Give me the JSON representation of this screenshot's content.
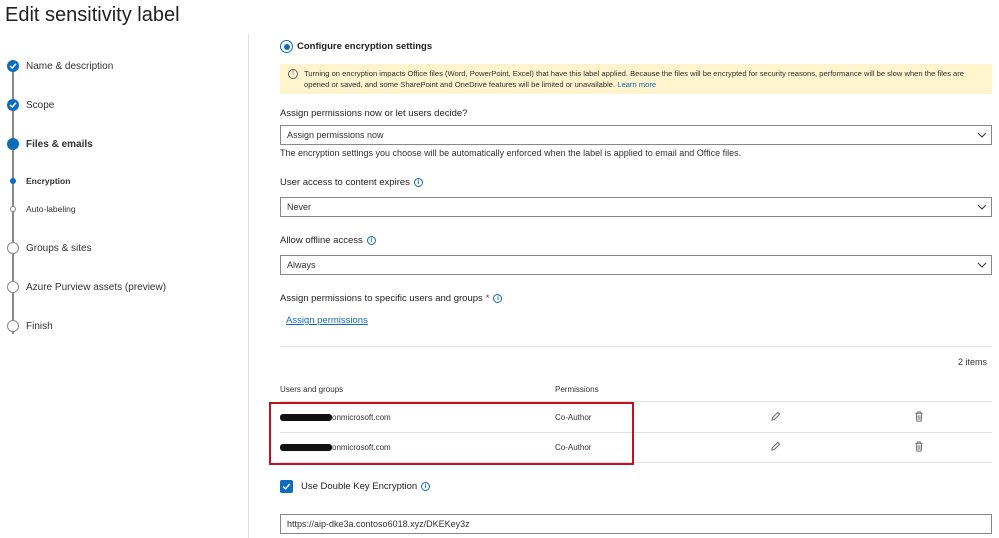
{
  "page": {
    "title": "Edit sensitivity label"
  },
  "wizard": {
    "steps": [
      {
        "label": "Name & description",
        "state": "done"
      },
      {
        "label": "Scope",
        "state": "done"
      },
      {
        "label": "Files & emails",
        "state": "current"
      },
      {
        "label": "Encryption",
        "state": "sub-active"
      },
      {
        "label": "Auto-labeling",
        "state": "sub-todo"
      },
      {
        "label": "Groups & sites",
        "state": "todo"
      },
      {
        "label": "Azure Purview assets (preview)",
        "state": "todo"
      },
      {
        "label": "Finish",
        "state": "todo"
      }
    ]
  },
  "encryption": {
    "configure_label": "Configure encryption settings",
    "banner_text": "Turning on encryption impacts Office files (Word, PowerPoint, Excel) that have this label applied. Because the files will be encrypted for security reasons, performance will be slow when the files are opened or saved, and some SharePoint and OneDrive features will be limited or unavailable.",
    "banner_link": "Learn more",
    "assign_question": "Assign permissions now or let users decide?",
    "assign_value": "Assign permissions now",
    "assign_helper": "The encryption settings you choose will be automatically enforced when the label is applied to email and Office files.",
    "expires_label": "User access to content expires",
    "expires_value": "Never",
    "offline_label": "Allow offline access",
    "offline_value": "Always",
    "specific_label": "Assign permissions to specific users and groups",
    "required_mark": "*",
    "assign_link": "Assign permissions",
    "items_count": "2 items",
    "columns": {
      "users": "Users and groups",
      "permissions": "Permissions"
    },
    "rows": [
      {
        "user": "onmicrosoft.com",
        "permission": "Co-Author"
      },
      {
        "user": "onmicrosoft.com",
        "permission": "Co-Author"
      }
    ],
    "dke_label": "Use Double Key Encryption",
    "dke_checked": true,
    "dke_url": "https://aip-dke3a.contoso6018.xyz/DKEKey3z"
  },
  "colors": {
    "accent": "#0f6cbd",
    "highlight": "#c50f1f",
    "banner": "#fff4ce"
  }
}
